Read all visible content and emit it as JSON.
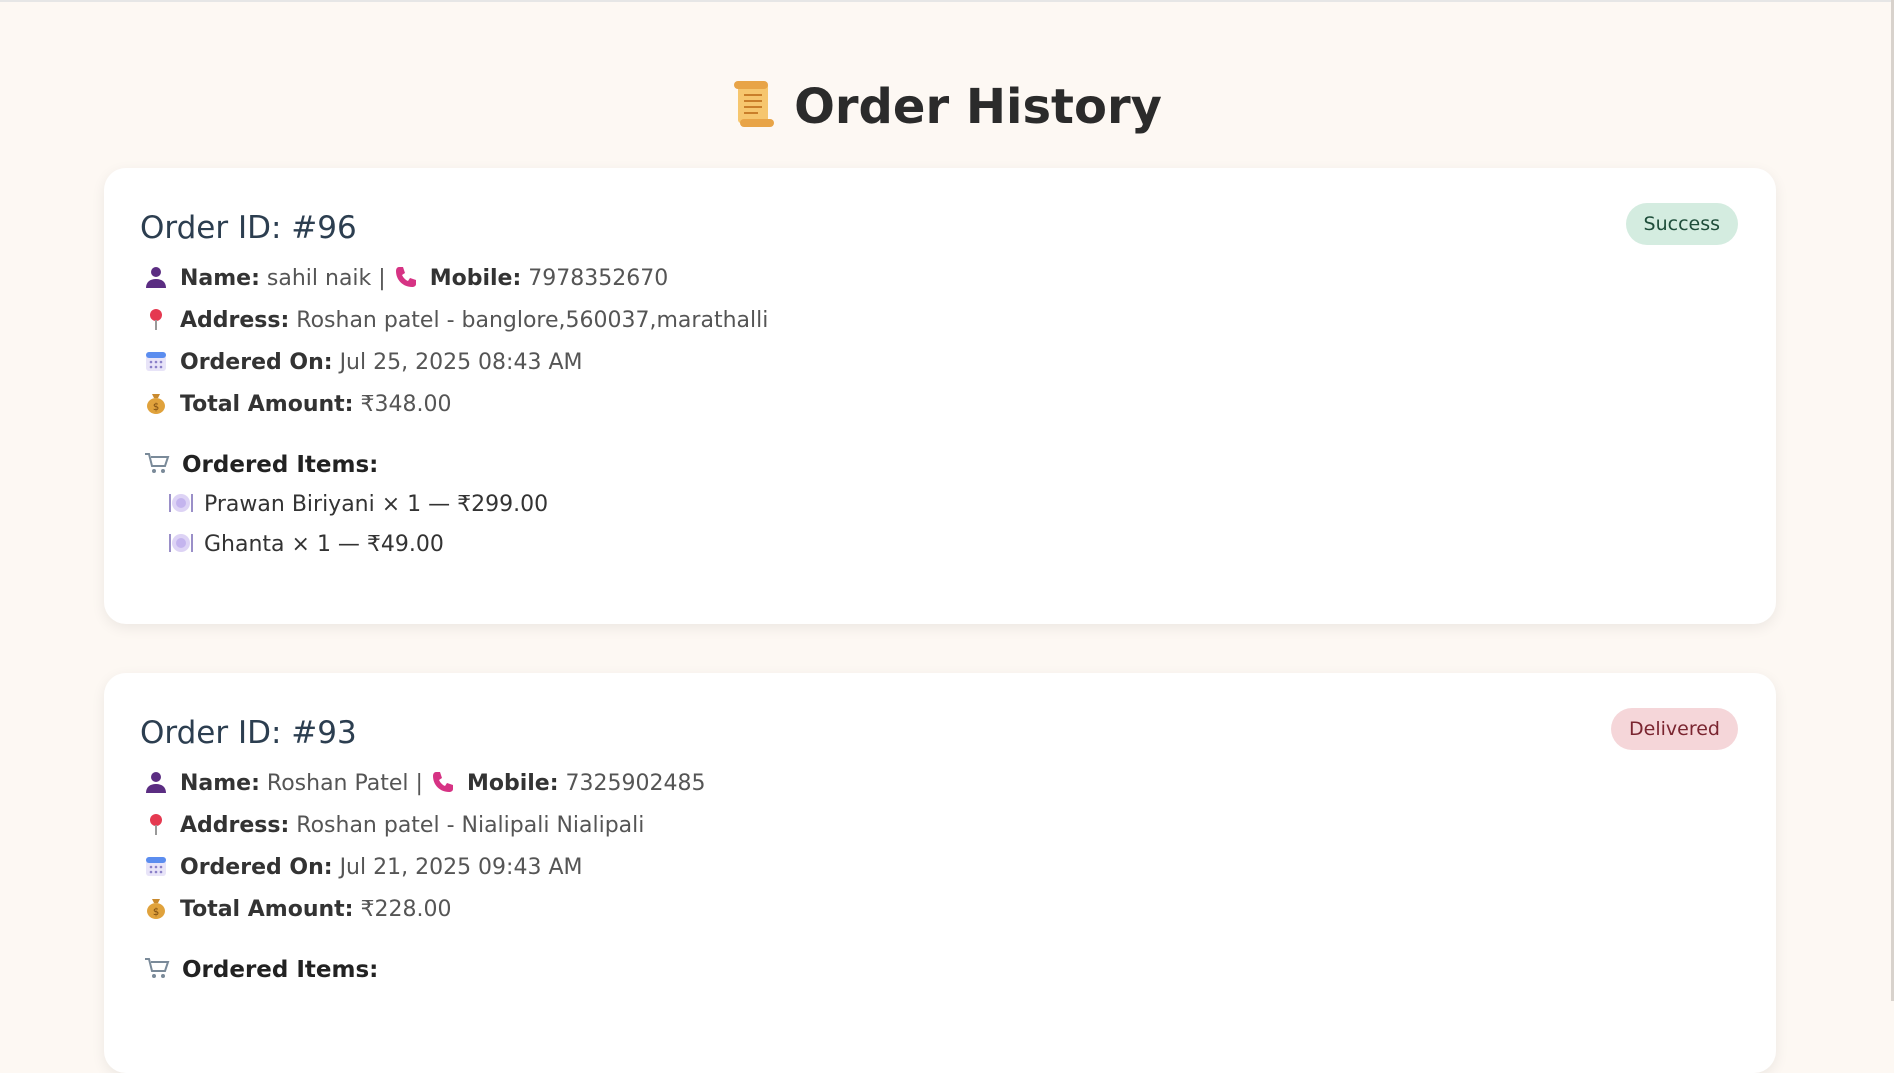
{
  "page": {
    "title": "Order History",
    "title_icon": "scroll-icon"
  },
  "labels": {
    "name": "Name:",
    "mobile": "Mobile:",
    "address": "Address:",
    "ordered_on": "Ordered On:",
    "total_amount": "Total Amount:",
    "ordered_items": "Ordered Items:",
    "separator": "|"
  },
  "icons": {
    "name": "user-icon",
    "mobile": "phone-icon",
    "address": "pin-icon",
    "ordered_on": "calendar-icon",
    "total_amount": "money-bag-icon",
    "ordered_items": "cart-icon",
    "item": "plate-icon"
  },
  "colors": {
    "background": "#fdf8f3",
    "card": "#ffffff",
    "success_badge_bg": "#d4ece0",
    "success_badge_text": "#1e4d3a",
    "delivered_badge_bg": "#f5d6d9",
    "delivered_badge_text": "#7a2530"
  },
  "orders": [
    {
      "id_text": "Order ID: #96",
      "status": "Success",
      "name": "sahil naik",
      "mobile": "7978352670",
      "address": "Roshan patel - banglore,560037,marathalli",
      "ordered_on": "Jul 25, 2025 08:43 AM",
      "total_amount": "₹348.00",
      "items": [
        {
          "text": "Prawan Biriyani × 1 — ₹299.00"
        },
        {
          "text": "Ghanta × 1 — ₹49.00"
        }
      ]
    },
    {
      "id_text": "Order ID: #93",
      "status": "Delivered",
      "name": "Roshan Patel",
      "mobile": "7325902485",
      "address": "Roshan patel - Nialipali Nialipali",
      "ordered_on": "Jul 21, 2025 09:43 AM",
      "total_amount": "₹228.00",
      "items": []
    }
  ]
}
